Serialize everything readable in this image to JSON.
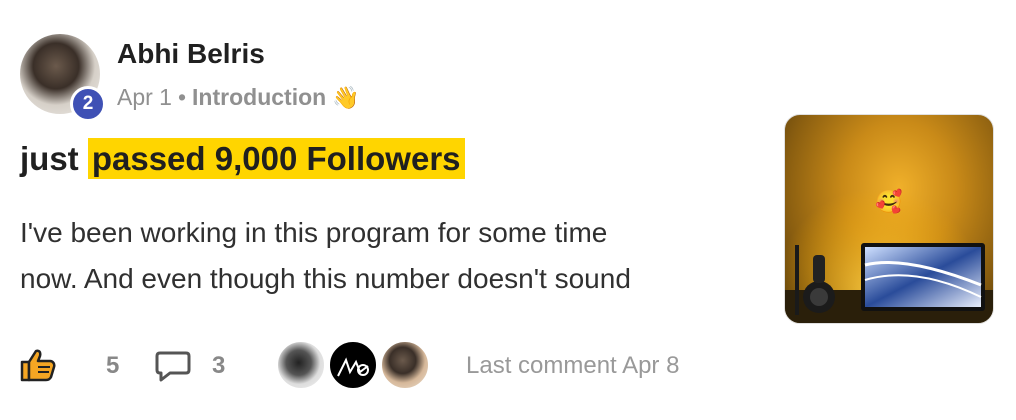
{
  "post": {
    "author": "Abhi Belris",
    "author_level": "2",
    "date": "Apr 1",
    "separator": "•",
    "category": "Introduction",
    "category_emoji": "👋",
    "title_prefix": "just ",
    "title_highlight": "passed 9,000 Followers",
    "body_line1": "I've been working in this program for some time",
    "body_line2": "now. And even though this number doesn't sound",
    "thumbnail_emoji": "🥰"
  },
  "footer": {
    "like_count": "5",
    "comment_count": "3",
    "last_comment": "Last comment Apr 8"
  },
  "colors": {
    "highlight": "#ffd500",
    "level_badge": "#3f51b5",
    "like_icon_fill": "#f5a623",
    "muted_text": "#909090"
  },
  "icons": {
    "like": "thumbs-up-icon",
    "comment": "comment-bubble-icon"
  }
}
